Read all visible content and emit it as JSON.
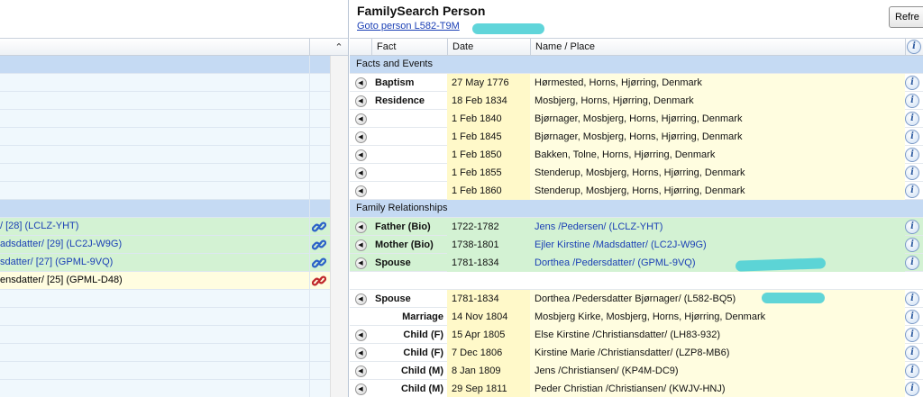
{
  "left": {
    "rows": [
      {
        "kind": "section",
        "text": ""
      },
      {
        "kind": "plain",
        "text": ""
      },
      {
        "kind": "plain",
        "text": ""
      },
      {
        "kind": "plain",
        "text": ""
      },
      {
        "kind": "plain",
        "text": ""
      },
      {
        "kind": "plain",
        "text": ""
      },
      {
        "kind": "plain",
        "text": ""
      },
      {
        "kind": "plain",
        "text": ""
      },
      {
        "kind": "section",
        "text": ""
      },
      {
        "kind": "green",
        "text": "/ [28] (LCLZ-YHT)",
        "link": "blue"
      },
      {
        "kind": "green",
        "text": "adsdatter/ [29] (LC2J-W9G)",
        "link": "blue"
      },
      {
        "kind": "green",
        "text": "sdatter/ [27] (GPML-9VQ)",
        "link": "blue"
      },
      {
        "kind": "yellow",
        "text": "ensdatter/ [25] (GPML-D48)",
        "link": "red"
      },
      {
        "kind": "plain",
        "text": ""
      },
      {
        "kind": "plain",
        "text": ""
      },
      {
        "kind": "plain",
        "text": ""
      },
      {
        "kind": "plain",
        "text": ""
      },
      {
        "kind": "plain",
        "text": ""
      },
      {
        "kind": "plain",
        "text": ""
      }
    ]
  },
  "right": {
    "title": "FamilySearch Person",
    "goto_link": "Goto person L582-T9M",
    "refresh_label": "Refre",
    "columns": {
      "fact": "Fact",
      "date": "Date",
      "place": "Name / Place"
    },
    "facts_section": "Facts and Events",
    "relationships_section": "Family Relationships",
    "facts": [
      {
        "fact": "Baptism",
        "date": "27 May 1776",
        "place": "Hørmested, Horns, Hjørring, Denmark"
      },
      {
        "fact": "Residence",
        "date": "18 Feb 1834",
        "place": "Mosbjerg, Horns, Hjørring, Denmark"
      },
      {
        "fact": "",
        "date": "1 Feb 1840",
        "place": "Bjørnager, Mosbjerg, Horns, Hjørring, Denmark"
      },
      {
        "fact": "",
        "date": "1 Feb 1845",
        "place": "Bjørnager, Mosbjerg, Horns, Hjørring, Denmark"
      },
      {
        "fact": "",
        "date": "1 Feb 1850",
        "place": "Bakken, Tolne, Horns, Hjørring, Denmark"
      },
      {
        "fact": "",
        "date": "1 Feb 1855",
        "place": "Stenderup, Mosbjerg, Horns, Hjørring, Denmark"
      },
      {
        "fact": "",
        "date": "1 Feb 1860",
        "place": "Stenderup, Mosbjerg, Horns, Hjørring, Denmark"
      }
    ],
    "relationships": [
      {
        "fact": "Father (Bio)",
        "date": "1722-1782",
        "place": "Jens /Pedersen/ (LCLZ-YHT)",
        "green": true,
        "arrow": true
      },
      {
        "fact": "Mother (Bio)",
        "date": "1738-1801",
        "place": "Ejler Kirstine /Madsdatter/ (LC2J-W9G)",
        "green": true,
        "arrow": true
      },
      {
        "fact": "Spouse",
        "date": "1781-1834",
        "place": "Dorthea /Pedersdatter/ (GPML-9VQ)",
        "green": true,
        "arrow": true
      },
      {
        "fact": "",
        "date": "",
        "place": "",
        "blank": true
      },
      {
        "fact": "Spouse",
        "date": "1781-1834",
        "place": "Dorthea /Pedersdatter Bjørnager/ (L582-BQ5)",
        "arrow": true
      },
      {
        "fact": "Marriage",
        "date": "14 Nov 1804",
        "place": "Mosbjerg Kirke, Mosbjerg, Horns, Hjørring, Denmark",
        "right": true
      },
      {
        "fact": "Child (F)",
        "date": "15 Apr 1805",
        "place": "Else Kirstine /Christiansdatter/ (LH83-932)",
        "right": true,
        "arrow": true
      },
      {
        "fact": "Child (F)",
        "date": "7 Dec 1806",
        "place": "Kirstine Marie /Christiansdatter/ (LZP8-MB6)",
        "right": true,
        "arrow": true
      },
      {
        "fact": "Child (M)",
        "date": "8 Jan 1809",
        "place": "Jens /Christiansen/ (KP4M-DC9)",
        "right": true,
        "arrow": true
      },
      {
        "fact": "Child (M)",
        "date": "29 Sep 1811",
        "place": "Peder Christian /Christiansen/ (KWJV-HNJ)",
        "right": true,
        "arrow": true
      }
    ]
  },
  "colors": {
    "section": "#c5daf3",
    "green_row": "#d3f2d3",
    "yellow_row": "#fffde0",
    "link": "#1a3fb5",
    "highlight": "#4fd0d6"
  }
}
